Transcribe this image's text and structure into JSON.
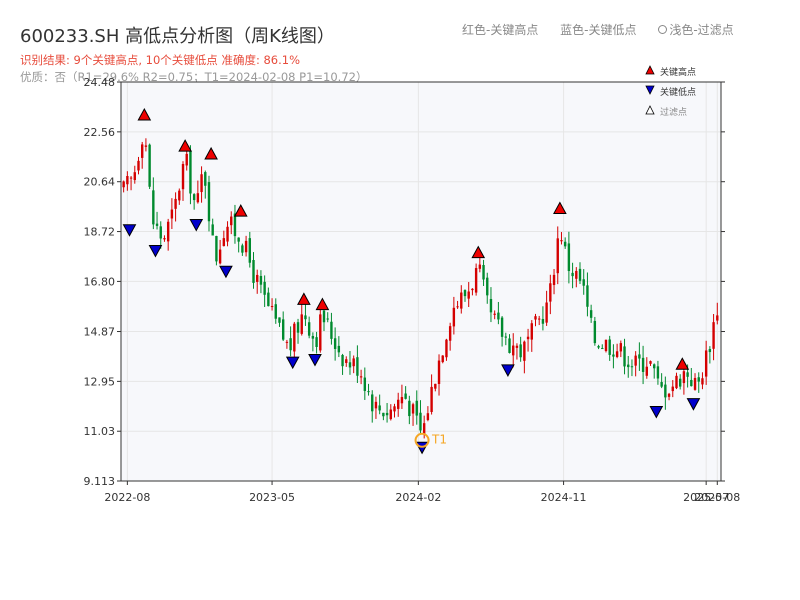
{
  "header": {
    "title": "600233.SH 高低点分析图（周K线图）",
    "summary": "识别结果: 9个关键高点, 10个关键低点   准确度: 86.1%",
    "quality": "优质：否（R1=29.6%  R2=0.75；T1=2024-02-08 P1=10.72）"
  },
  "top_legend": {
    "red": "红色-关键高点",
    "blue": "蓝色-关键低点",
    "light": "浅色-过滤点"
  },
  "legend": {
    "high": "关键高点",
    "low": "关键低点",
    "filtered": "过滤点"
  },
  "colors": {
    "up": "#d40000",
    "down": "#008a2e",
    "high_marker": "#ee0000",
    "low_marker": "#0000cc",
    "t1_marker": "#f5a623",
    "plot_bg": "#f7f8fb",
    "grid": "#e6e6e6"
  },
  "chart_data": {
    "type": "candlestick",
    "frequency": "weekly",
    "ylim": [
      9.113,
      24.48
    ],
    "yticks": [
      "24.48",
      "22.56",
      "20.64",
      "18.72",
      "16.80",
      "14.87",
      "12.95",
      "11.03",
      "9.113"
    ],
    "xlim": [
      "2022-07-20",
      "2025-08-25"
    ],
    "xticks": [
      {
        "label": "2022-08",
        "date": "2022-08-01"
      },
      {
        "label": "2023-05",
        "date": "2023-05-01"
      },
      {
        "label": "2024-02",
        "date": "2024-02-01"
      },
      {
        "label": "2024-11",
        "date": "2024-11-01"
      },
      {
        "label": "2025-07",
        "date": "2025-07-28"
      },
      {
        "label": "2025-08",
        "date": "2025-08-18"
      }
    ],
    "close_path": [
      [
        "2022-07-25",
        20.3
      ],
      [
        "2022-08-12",
        20.8
      ],
      [
        "2022-09-02",
        22.9
      ],
      [
        "2022-09-16",
        19.2
      ],
      [
        "2022-10-07",
        18.4
      ],
      [
        "2022-10-28",
        19.5
      ],
      [
        "2022-11-18",
        21.6
      ],
      [
        "2022-12-09",
        19.5
      ],
      [
        "2022-12-23",
        21.3
      ],
      [
        "2023-01-13",
        17.6
      ],
      [
        "2023-02-03",
        19.1
      ],
      [
        "2023-03-03",
        18.5
      ],
      [
        "2023-04-07",
        16.5
      ],
      [
        "2023-05-05",
        15.3
      ],
      [
        "2023-06-02",
        14.2
      ],
      [
        "2023-06-30",
        15.7
      ],
      [
        "2023-07-21",
        14.5
      ],
      [
        "2023-08-04",
        15.5
      ],
      [
        "2023-08-25",
        14.6
      ],
      [
        "2023-09-15",
        13.8
      ],
      [
        "2023-10-13",
        13.5
      ],
      [
        "2023-11-10",
        12.0
      ],
      [
        "2023-12-08",
        11.8
      ],
      [
        "2024-01-05",
        12.5
      ],
      [
        "2024-02-08",
        10.9
      ],
      [
        "2024-03-01",
        13.0
      ],
      [
        "2024-04-05",
        15.8
      ],
      [
        "2024-05-03",
        16.4
      ],
      [
        "2024-05-24",
        17.3
      ],
      [
        "2024-06-14",
        15.5
      ],
      [
        "2024-07-19",
        14.5
      ],
      [
        "2024-08-16",
        14.1
      ],
      [
        "2024-09-13",
        15.2
      ],
      [
        "2024-10-04",
        16.0
      ],
      [
        "2024-10-25",
        19.0
      ],
      [
        "2024-11-08",
        17.5
      ],
      [
        "2024-12-06",
        16.7
      ],
      [
        "2024-12-27",
        14.6
      ],
      [
        "2025-02-07",
        14.3
      ],
      [
        "2025-03-14",
        13.6
      ],
      [
        "2025-04-11",
        13.8
      ],
      [
        "2025-05-02",
        12.6
      ],
      [
        "2025-05-30",
        12.9
      ],
      [
        "2025-06-20",
        13.4
      ],
      [
        "2025-07-11",
        12.7
      ],
      [
        "2025-08-01",
        14.2
      ],
      [
        "2025-08-22",
        16.2
      ]
    ],
    "key_highs": [
      {
        "date": "2022-09-02",
        "price": 22.9
      },
      {
        "date": "2022-11-18",
        "price": 21.7
      },
      {
        "date": "2023-01-06",
        "price": 21.4
      },
      {
        "date": "2023-03-03",
        "price": 19.2
      },
      {
        "date": "2023-06-30",
        "price": 15.8
      },
      {
        "date": "2023-08-04",
        "price": 15.6
      },
      {
        "date": "2024-05-24",
        "price": 17.6
      },
      {
        "date": "2024-10-25",
        "price": 19.3
      },
      {
        "date": "2025-06-13",
        "price": 13.3
      }
    ],
    "key_lows": [
      {
        "date": "2022-08-05",
        "price": 19.1
      },
      {
        "date": "2022-09-23",
        "price": 18.3
      },
      {
        "date": "2022-12-09",
        "price": 19.3
      },
      {
        "date": "2023-02-03",
        "price": 17.5
      },
      {
        "date": "2023-06-09",
        "price": 14.0
      },
      {
        "date": "2023-07-21",
        "price": 14.1
      },
      {
        "date": "2024-02-08",
        "price": 10.72
      },
      {
        "date": "2024-07-19",
        "price": 13.7
      },
      {
        "date": "2025-04-25",
        "price": 12.1
      },
      {
        "date": "2025-07-04",
        "price": 12.4
      }
    ],
    "t1": {
      "label": "T1",
      "date": "2024-02-08",
      "price": 10.72
    }
  }
}
